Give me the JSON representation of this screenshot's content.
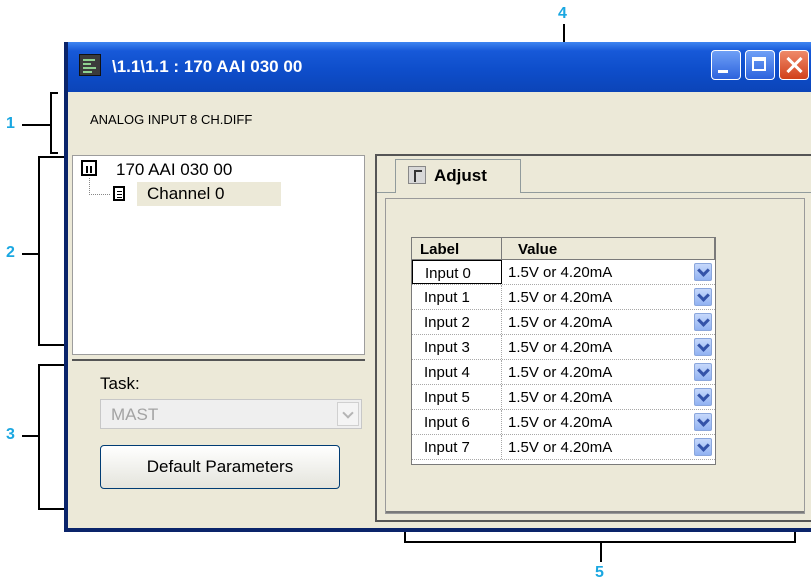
{
  "callouts": [
    "1",
    "2",
    "3",
    "4",
    "5"
  ],
  "window": {
    "title": "\\1.1\\1.1 : 170 AAI 030 00",
    "icon": "module-icon",
    "accent": "#0b4ac8"
  },
  "header": {
    "text": "ANALOG INPUT 8 CH.DIFF"
  },
  "tree": {
    "root": "170 AAI 030 00",
    "child": "Channel 0"
  },
  "task": {
    "label": "Task:",
    "value": "MAST",
    "default_button": "Default Parameters"
  },
  "tab": {
    "label": "Adjust",
    "icon": "adjust-icon"
  },
  "grid": {
    "headers": [
      "Label",
      "Value"
    ],
    "rows": [
      {
        "label": "Input 0",
        "value": "1.5V or 4.20mA"
      },
      {
        "label": "Input 1",
        "value": "1.5V or 4.20mA"
      },
      {
        "label": "Input 2",
        "value": "1.5V or 4.20mA"
      },
      {
        "label": "Input 3",
        "value": "1.5V or 4.20mA"
      },
      {
        "label": "Input 4",
        "value": "1.5V or 4.20mA"
      },
      {
        "label": "Input 5",
        "value": "1.5V or 4.20mA"
      },
      {
        "label": "Input 6",
        "value": "1.5V or 4.20mA"
      },
      {
        "label": "Input 7",
        "value": "1.5V or 4.20mA"
      }
    ]
  }
}
